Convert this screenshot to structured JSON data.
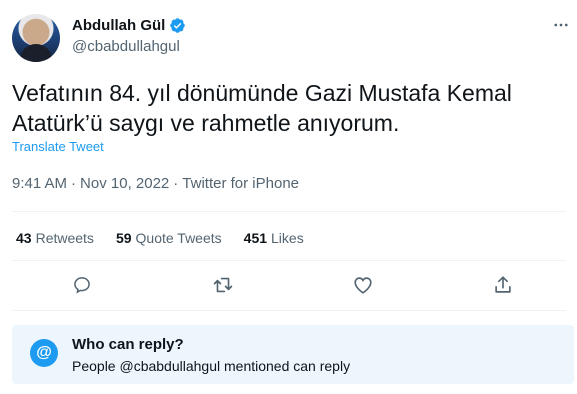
{
  "author": {
    "display_name": "Abdullah Gül",
    "handle": "@cbabdullahgul",
    "verified": true
  },
  "tweet": {
    "text": "Vefatının 84. yıl dönümünde Gazi Mustafa Kemal Atatürk’ü saygı ve rahmetle anıyorum.",
    "translate_label": "Translate Tweet",
    "time": "9:41 AM",
    "date": "Nov 10, 2022",
    "source": "Twitter for iPhone",
    "separator": "·"
  },
  "stats": {
    "retweets": {
      "count": "43",
      "label": "Retweets"
    },
    "quote_tweets": {
      "count": "59",
      "label": "Quote Tweets"
    },
    "likes": {
      "count": "451",
      "label": "Likes"
    }
  },
  "actions": {
    "icons": [
      "reply-icon",
      "retweet-icon",
      "like-icon",
      "share-icon"
    ]
  },
  "reply_settings": {
    "icon_glyph": "@",
    "title": "Who can reply?",
    "subtitle": "People @cbabdullahgul mentioned can reply"
  },
  "colors": {
    "accent": "#1d9bf0",
    "text": "#0f1419",
    "secondary": "#536471",
    "reply_box_bg": "#edf6fd"
  }
}
